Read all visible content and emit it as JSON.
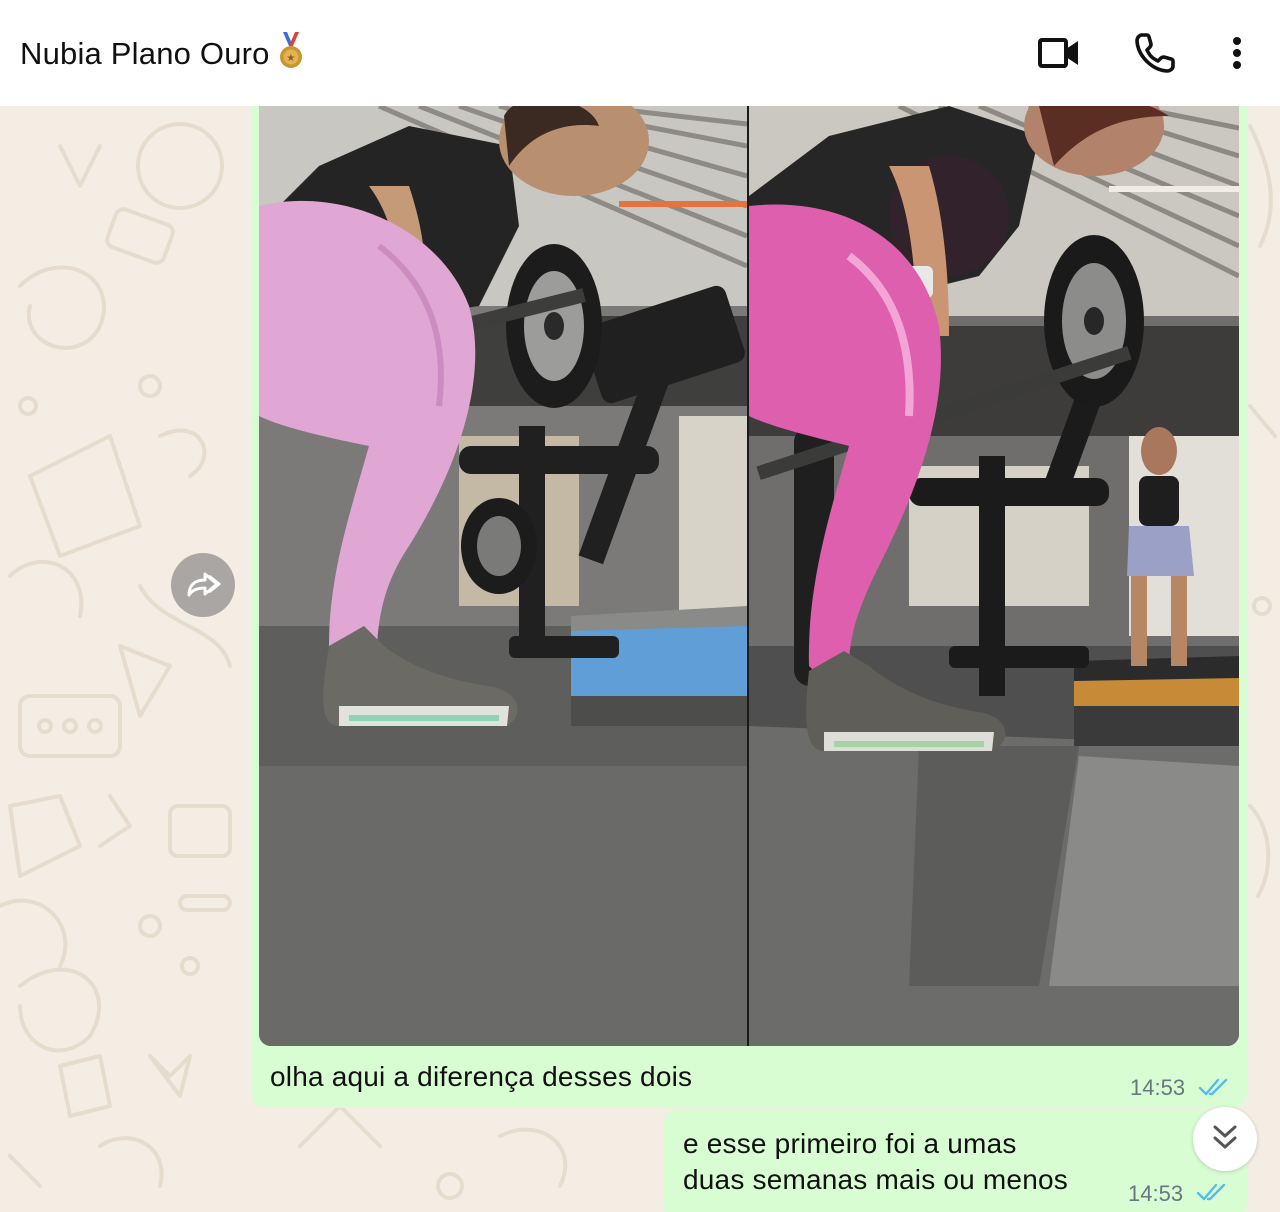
{
  "header": {
    "contact_name": "Nubia Plano Ouro",
    "contact_emoji": "medal-icon",
    "actions": [
      "video-call-icon",
      "phone-call-icon",
      "more-vert-icon"
    ]
  },
  "colors": {
    "header_bg": "#ffffff",
    "chat_bg": "#f3ede4",
    "outgoing_bubble": "#d9fdd3",
    "read_ticks": "#53bdeb",
    "time_text": "#667781"
  },
  "messages": [
    {
      "type": "image",
      "image_description_icon": "photo-comparison",
      "caption": "olha aqui a diferença desses dois",
      "time": "14:53",
      "status": "read"
    },
    {
      "type": "text",
      "lines": [
        "e esse primeiro foi a umas",
        "duas semanas mais ou menos"
      ],
      "time": "14:53",
      "status": "read"
    }
  ],
  "controls": {
    "forward_icon": "forward-icon",
    "scroll_down_icon": "scroll-down-icon"
  }
}
